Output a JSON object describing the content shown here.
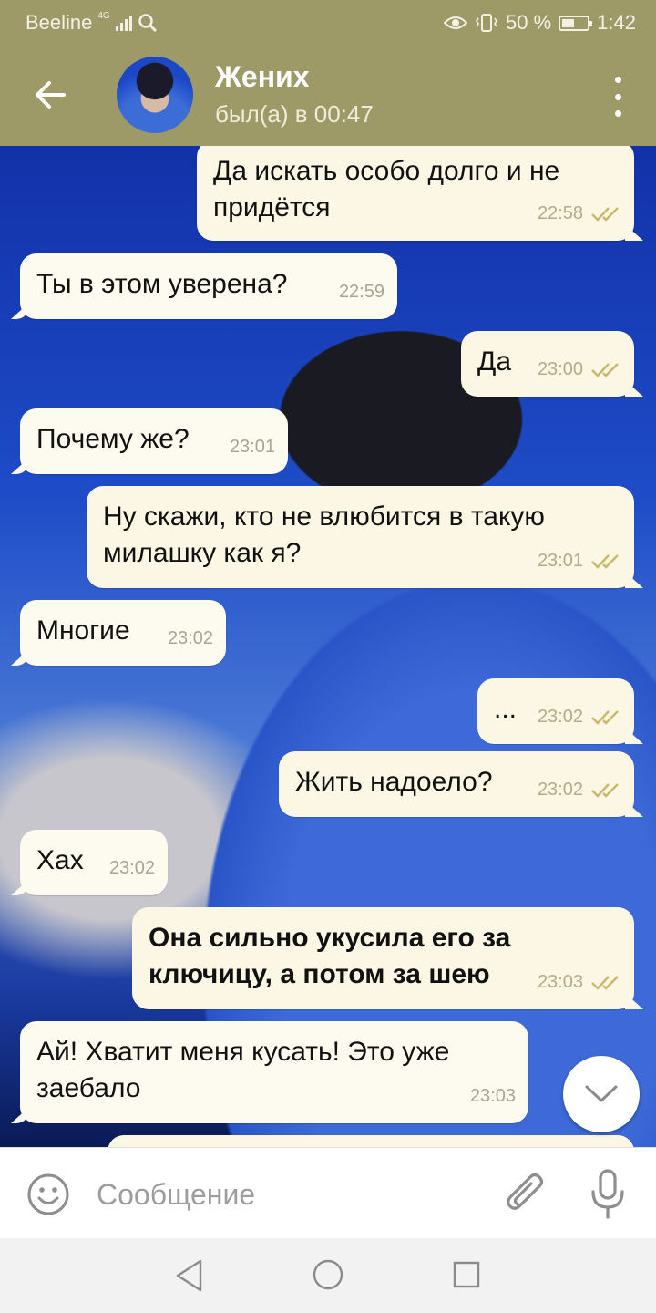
{
  "status_bar": {
    "carrier": "Beeline",
    "network_type": "4G",
    "battery_percent": "50 %",
    "battery_level": 0.5,
    "time": "1:42"
  },
  "header": {
    "contact_name": "Жених",
    "last_seen": "был(а) в 00:47",
    "back_icon": "arrow-left-icon",
    "menu_icon": "more-vert-icon"
  },
  "messages": [
    {
      "dir": "out",
      "text": "Да искать особо долго и не придётся",
      "time": "22:58",
      "read": true
    },
    {
      "dir": "in",
      "text": "Ты в этом уверена?",
      "time": "22:59"
    },
    {
      "dir": "out",
      "text": "Да",
      "time": "23:00",
      "read": true
    },
    {
      "dir": "in",
      "text": "Почему же?",
      "time": "23:01"
    },
    {
      "dir": "out",
      "text": "Ну скажи, кто не влюбится в такую милашку как я?",
      "time": "23:01",
      "read": true
    },
    {
      "dir": "in",
      "text": "Многие",
      "time": "23:02"
    },
    {
      "dir": "out",
      "text": "...",
      "time": "23:02",
      "read": true
    },
    {
      "dir": "out",
      "text": "Жить надоело?",
      "time": "23:02",
      "read": true
    },
    {
      "dir": "in",
      "text": "Хах",
      "time": "23:02"
    },
    {
      "dir": "out",
      "text": "Она сильно укусила его за ключицу, а потом за шею",
      "time": "23:03",
      "read": true
    },
    {
      "dir": "in",
      "text": "Ай! Хватит меня кусать! Это уже заебало",
      "time": "23:03"
    }
  ],
  "input": {
    "placeholder": "Сообщение",
    "value": ""
  },
  "colors": {
    "header_bg": "#9e9a67",
    "bubble_bg": "#fdfbf0",
    "tick_color": "#c8b86a"
  }
}
